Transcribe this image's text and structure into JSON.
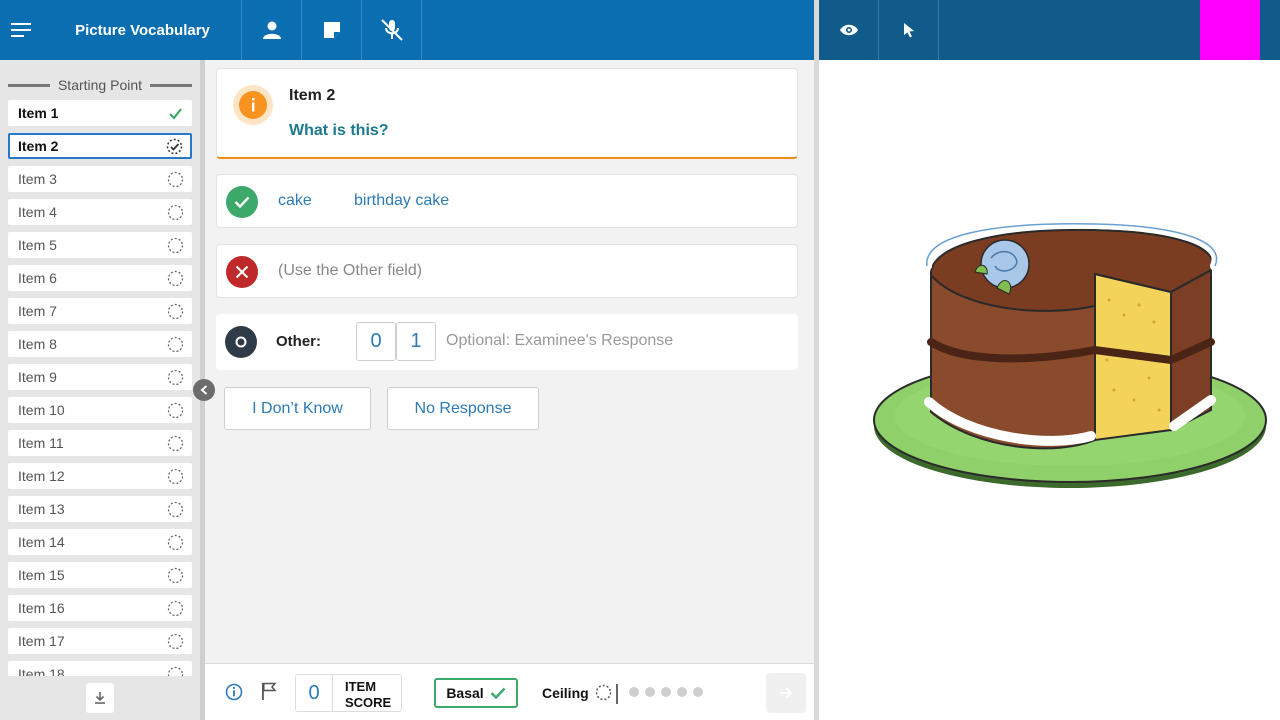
{
  "header": {
    "title": "Picture Vocabulary",
    "icons": [
      "menu-icon",
      "person-icon",
      "note-icon",
      "mic-off-icon",
      "eye-icon",
      "pointer-icon"
    ]
  },
  "sidebar": {
    "starting_point": "Starting Point",
    "items": [
      {
        "label": "Item 1",
        "state": "done"
      },
      {
        "label": "Item 2",
        "state": "current"
      },
      {
        "label": "Item 3",
        "state": "pending"
      },
      {
        "label": "Item 4",
        "state": "pending"
      },
      {
        "label": "Item 5",
        "state": "pending"
      },
      {
        "label": "Item 6",
        "state": "pending"
      },
      {
        "label": "Item 7",
        "state": "pending"
      },
      {
        "label": "Item 8",
        "state": "pending"
      },
      {
        "label": "Item 9",
        "state": "pending"
      },
      {
        "label": "Item 10",
        "state": "pending"
      },
      {
        "label": "Item 11",
        "state": "pending"
      },
      {
        "label": "Item 12",
        "state": "pending"
      },
      {
        "label": "Item 13",
        "state": "pending"
      },
      {
        "label": "Item 14",
        "state": "pending"
      },
      {
        "label": "Item 15",
        "state": "pending"
      },
      {
        "label": "Item 16",
        "state": "pending"
      },
      {
        "label": "Item 17",
        "state": "pending"
      },
      {
        "label": "Item 18",
        "state": "pending"
      }
    ]
  },
  "item": {
    "title": "Item 2",
    "question": "What is this?"
  },
  "responses": {
    "correct": [
      "cake",
      "birthday cake"
    ],
    "incorrect_hint": "(Use the Other field)",
    "other_label": "Other:",
    "other_scores": [
      "0",
      "1"
    ],
    "other_placeholder": "Optional: Examinee's Response"
  },
  "buttons": {
    "dont_know": "I Don’t Know",
    "no_response": "No Response"
  },
  "bottom": {
    "item_score_value": "0",
    "item_score_label_1": "ITEM",
    "item_score_label_2": "SCORE",
    "basal_label": "Basal",
    "ceiling_label": "Ceiling",
    "progress_dots": 5
  },
  "colors": {
    "header_blue": "#0a6eb1",
    "header_dark": "#115b8a",
    "accent_orange": "#f7931e",
    "correct_green": "#3ca86a",
    "incorrect_red": "#c0292b",
    "link_blue": "#2c7bb5",
    "magenta": "#ff00ff"
  }
}
